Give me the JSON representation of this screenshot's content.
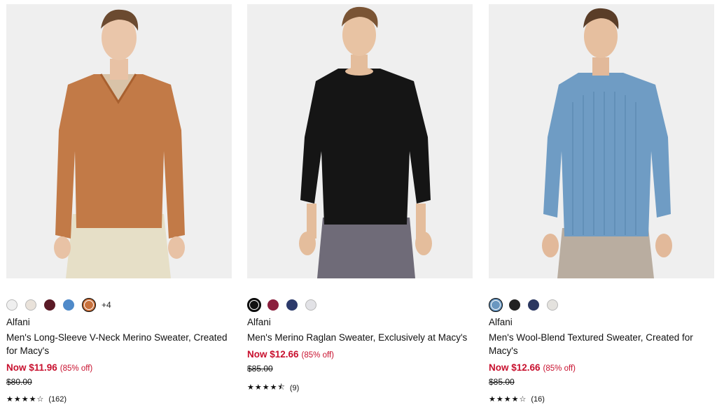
{
  "products": [
    {
      "brand": "Alfani",
      "title_line1": "Men's Long-Sleeve V-Neck Merino Sweater, Created",
      "title_line2": "for Macy's",
      "price_now": "Now $11.96",
      "discount": "(85% off)",
      "price_original": "$80.00",
      "stars": "★★★★☆",
      "review_count": "(162)",
      "more_colors": "+4",
      "swatches": [
        "#efefef",
        "#e9e2da",
        "#5a1a26",
        "#4f8ac9",
        "#c8713d"
      ],
      "selected_swatch": 4,
      "sweater_color": "#c27a47",
      "pants_color": "#e6dfc7",
      "neck": "v"
    },
    {
      "brand": "Alfani",
      "title_line1": "Men's Merino Raglan Sweater, Exclusively at Macy's",
      "title_line2": "",
      "price_now": "Now $12.66",
      "discount": "(85% off)",
      "price_original": "$85.00",
      "stars": "★★★★⯪",
      "review_count": "(9)",
      "more_colors": "",
      "swatches": [
        "#111111",
        "#8b1f3d",
        "#2c3a6b",
        "#e2e2e6"
      ],
      "selected_swatch": 0,
      "sweater_color": "#151515",
      "pants_color": "#6f6b78",
      "neck": "crew"
    },
    {
      "brand": "Alfani",
      "title_line1": "Men's Wool-Blend Textured Sweater, Created for",
      "title_line2": "Macy's",
      "price_now": "Now $12.66",
      "discount": "(85% off)",
      "price_original": "$85.00",
      "stars": "★★★★☆",
      "review_count": "(16)",
      "more_colors": "",
      "swatches": [
        "#6a97c0",
        "#222222",
        "#2b3760",
        "#e4e2de"
      ],
      "selected_swatch": 0,
      "sweater_color": "#6f9cc4",
      "pants_color": "#b9ada0",
      "neck": "crew"
    }
  ]
}
